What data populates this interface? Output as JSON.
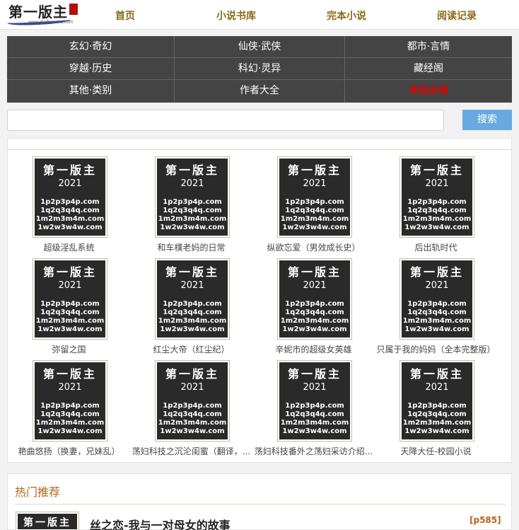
{
  "header": {
    "logo": {
      "text": "第一版主",
      "url": "www.diyibanzhu.com"
    },
    "nav": [
      "首页",
      "小说书库",
      "完本小说",
      "阅读记录"
    ]
  },
  "categories": [
    "玄幻·奇幻",
    "仙侠·武侠",
    "都市·言情",
    "穿越·历史",
    "科幻·灵异",
    "藏经阁",
    "其他·类别",
    "作者大全",
    "本站必读"
  ],
  "highlight_color": "#e00000",
  "search": {
    "placeholder": "",
    "value": "",
    "button": "搜索"
  },
  "cover": {
    "title": "第一版主",
    "year": "2021",
    "lines": [
      "1p2p3p4p.com",
      "1q2q3q4q.com",
      "1m2m3m4m.com",
      "1w2w3w4w.com"
    ]
  },
  "books": [
    "超级淫乱系统",
    "和车樸老妈的日常",
    "纵欲忘爱（男效成长史）",
    "后出轨时代",
    "弥留之国",
    "红尘大帝（红尘纪）",
    "辛妮市的超级女英雄",
    "只属于我的妈妈（全本完整版）",
    "艳曲悠扬（换妻，兄妹乱）",
    "荡妇科技之沉沦闺蜜（翻译，...",
    "荡妇科技番外之荡妇采访介绍...",
    "天降大任-校园小说"
  ],
  "hot": {
    "title": "热门推荐",
    "first_book": "丝之恋-我与一对母女的故事",
    "first_tag": "[p585]"
  }
}
